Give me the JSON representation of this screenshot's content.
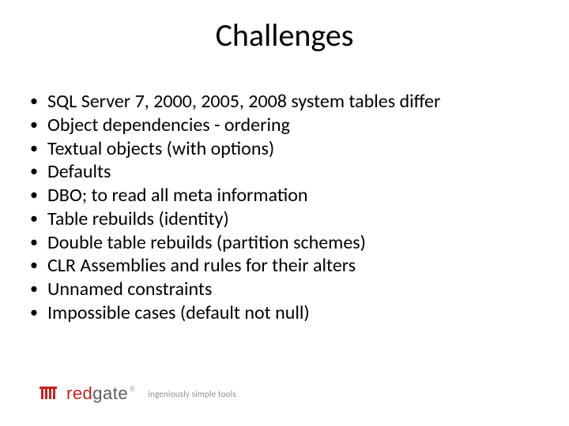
{
  "title": "Challenges",
  "bullets": [
    "SQL Server 7, 2000, 2005, 2008 system tables differ",
    "Object dependencies - ordering",
    "Textual objects (with options)",
    "Defaults",
    "DBO; to read all meta information",
    "Table rebuilds (identity)",
    "Double table rebuilds (partition schemes)",
    "CLR Assemblies and rules for their alters",
    "Unnamed constraints",
    "Impossible cases (default not null)"
  ],
  "logo": {
    "brand_red": "red",
    "brand_rest": "gate",
    "registered": "®",
    "tagline": "ingeniously simple tools"
  }
}
